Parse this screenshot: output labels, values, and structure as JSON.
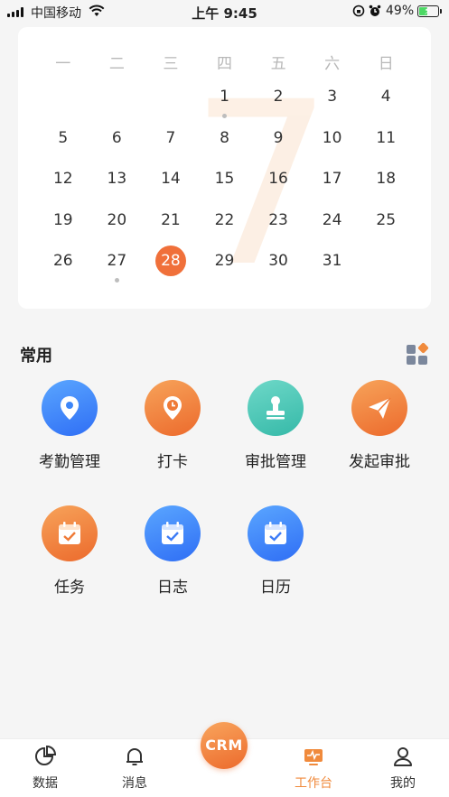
{
  "status_bar": {
    "carrier": "中国移动",
    "time": "上午 9:45",
    "battery_percent": "49%",
    "battery_level": 0.49
  },
  "calendar": {
    "month_watermark": "7",
    "weekdays": [
      "一",
      "二",
      "三",
      "四",
      "五",
      "六",
      "日"
    ],
    "weeks": [
      [
        "",
        "",
        "",
        "1",
        "2",
        "3",
        "4"
      ],
      [
        "5",
        "6",
        "7",
        "8",
        "9",
        "10",
        "11"
      ],
      [
        "12",
        "13",
        "14",
        "15",
        "16",
        "17",
        "18"
      ],
      [
        "19",
        "20",
        "21",
        "22",
        "23",
        "24",
        "25"
      ],
      [
        "26",
        "27",
        "28",
        "29",
        "30",
        "31",
        ""
      ]
    ],
    "today": "28",
    "days_with_events": [
      "1",
      "27"
    ],
    "accent_color": "#f0703a"
  },
  "common_section": {
    "title": "常用",
    "apps_icon": "apps-grid-icon"
  },
  "apps": [
    {
      "label": "考勤管理",
      "icon": "location-pin-icon",
      "color": "blue"
    },
    {
      "label": "打卡",
      "icon": "clock-pin-icon",
      "color": "orange"
    },
    {
      "label": "审批管理",
      "icon": "stamp-icon",
      "color": "teal"
    },
    {
      "label": "发起审批",
      "icon": "paper-plane-icon",
      "color": "orange"
    },
    {
      "label": "任务",
      "icon": "task-calendar-icon",
      "color": "orange"
    },
    {
      "label": "日志",
      "icon": "log-calendar-icon",
      "color": "blue"
    },
    {
      "label": "日历",
      "icon": "calendar-icon",
      "color": "blue"
    }
  ],
  "tabbar": {
    "items": [
      {
        "label": "数据",
        "icon": "pie-chart-icon",
        "active": false
      },
      {
        "label": "消息",
        "icon": "bell-icon",
        "active": false
      },
      {
        "label": "工作台",
        "icon": "workbench-icon",
        "active": true
      },
      {
        "label": "我的",
        "icon": "user-icon",
        "active": false
      }
    ],
    "center_button": "CRM",
    "active_color": "#f08a3c"
  }
}
